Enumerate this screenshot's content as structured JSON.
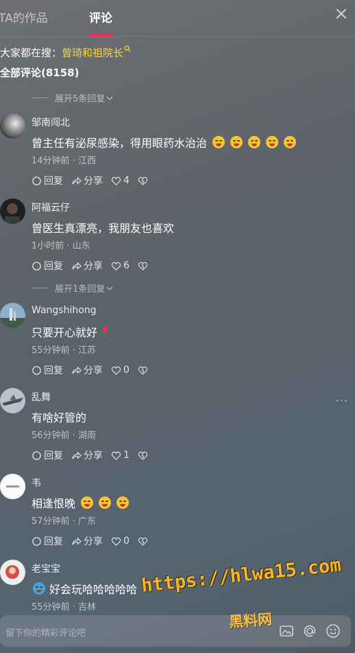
{
  "tabs": {
    "works": "TA的作品",
    "comments": "评论"
  },
  "search_hint": {
    "prefix": "大家都在搜：",
    "keyword": "曾琦和祖院长"
  },
  "total": "全部评论(8158)",
  "expand_top": "展开5条回复",
  "expand_mid": "展开1条回复",
  "reply_label": "回复",
  "share_label": "分享",
  "comments": [
    {
      "name": "邹南闯北",
      "text": "曾主任有泌尿感染，得用眼药水治治",
      "emoji_count": 5,
      "meta": "14分钟前 · 江西",
      "likes": "4"
    },
    {
      "name": "阿福云仔",
      "text": "曾医生真漂亮，我朋友也喜欢",
      "emoji_count": 0,
      "meta": "1小时前 · 山东",
      "likes": "6"
    },
    {
      "name": "Wangshihong",
      "text": "只要开心就好",
      "emoji_count": 0,
      "meta": "55分钟前 · 江苏",
      "likes": "0"
    },
    {
      "name": "乱舞",
      "text": "有啥好管的",
      "emoji_count": 0,
      "meta": "56分钟前 · 湖南",
      "likes": "1"
    },
    {
      "name": "韦",
      "text": "相逢恨晚",
      "emoji_count": 3,
      "meta": "57分钟前 · 广东",
      "likes": "0"
    },
    {
      "name": "老宝宝",
      "text": "好会玩哈哈哈哈哈",
      "emoji_count": 1,
      "meta": "55分钟前 · 吉林",
      "likes": ""
    }
  ],
  "watermark": {
    "url": "https://hlwa15.com",
    "name": "黑料网"
  },
  "input": {
    "placeholder": "留下你的精彩评论吧"
  },
  "colors": {
    "accent": "#fe2c55",
    "keyword": "#f6d33f",
    "watermark": "#f5b52e"
  }
}
